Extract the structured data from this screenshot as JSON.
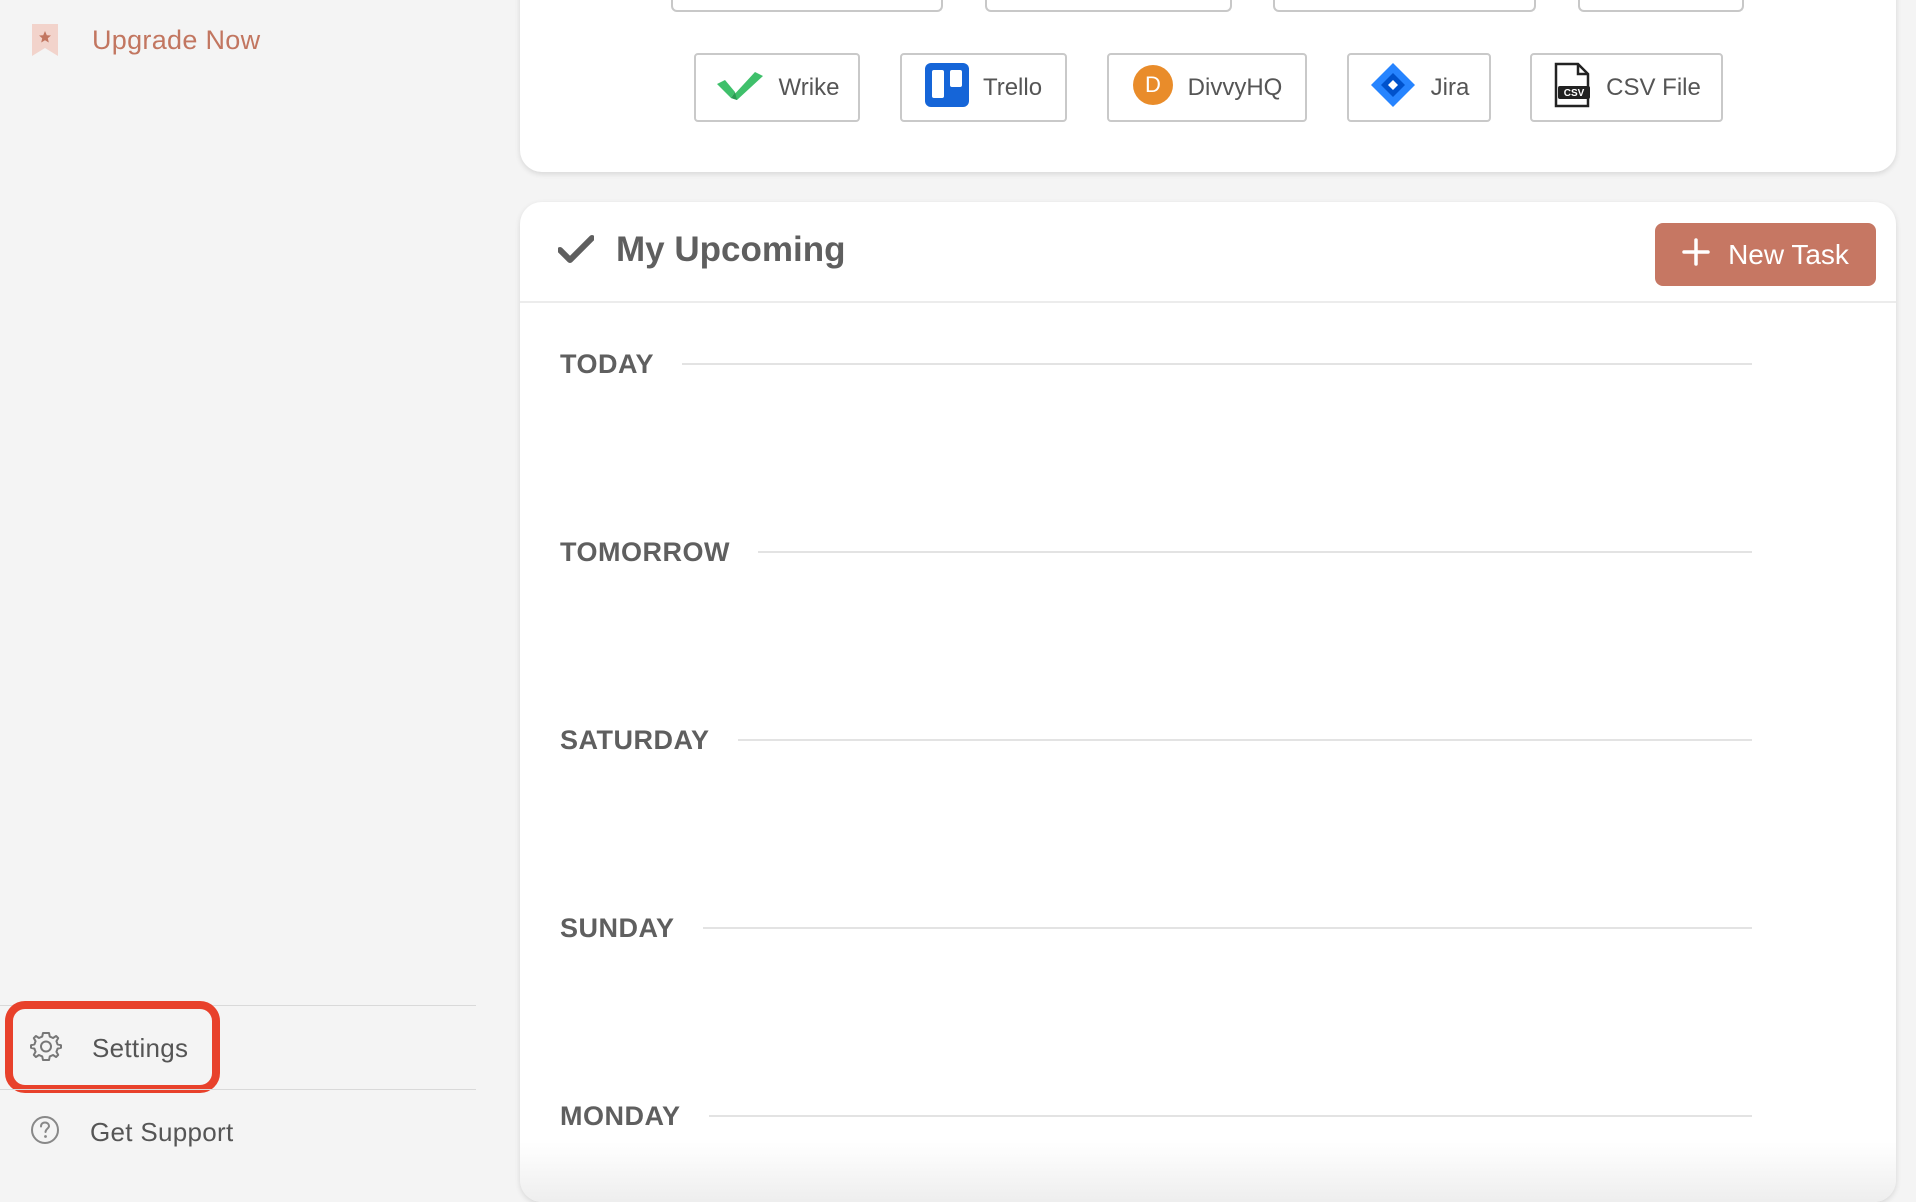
{
  "sidebar": {
    "upgrade_label": "Upgrade Now",
    "settings_label": "Settings",
    "support_label": "Get Support"
  },
  "integrations": [
    {
      "name": "Wrike",
      "icon": "wrike-icon"
    },
    {
      "name": "Trello",
      "icon": "trello-icon"
    },
    {
      "name": "DivvyHQ",
      "icon": "divvyhq-icon"
    },
    {
      "name": "Jira",
      "icon": "jira-icon"
    },
    {
      "name": "CSV File",
      "icon": "csv-file-icon"
    }
  ],
  "upcoming": {
    "title": "My Upcoming",
    "new_task_label": "New Task",
    "days": [
      "TODAY",
      "TOMORROW",
      "SATURDAY",
      "SUNDAY",
      "MONDAY"
    ]
  },
  "colors": {
    "accent": "#c67763",
    "upgrade_text": "#c27660",
    "highlight": "#e8412b",
    "wrike": "#3fc06b",
    "trello": "#1565d8",
    "divvyhq": "#e98c2a",
    "jira": "#2684ff"
  }
}
